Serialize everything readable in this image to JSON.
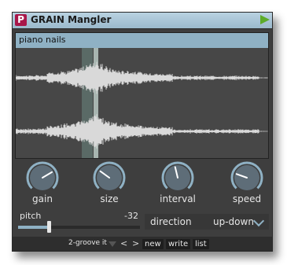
{
  "window": {
    "badge": "P",
    "title": "GRAIN Mangler"
  },
  "waveform": {
    "sample_name": "piano nails"
  },
  "knobs": [
    {
      "id": "gain",
      "label": "gain",
      "value": 0.72
    },
    {
      "id": "size",
      "label": "size",
      "value": 0.3
    },
    {
      "id": "interval",
      "label": "interval",
      "value": 0.45
    },
    {
      "id": "speed",
      "label": "speed",
      "value": 0.24
    }
  ],
  "pitch": {
    "label": "pitch",
    "value": "-32",
    "fraction": 0.25
  },
  "direction": {
    "label": "direction",
    "value": "up-down"
  },
  "footer": {
    "preset_name": "2-groove it",
    "prev": "<",
    "next": ">",
    "new_label": "new",
    "write_label": "write",
    "list_label": "list"
  },
  "colors": {
    "accent": "#8fb1c4",
    "badge": "#a8174a",
    "play": "#5cab2a"
  },
  "icons": {
    "play": "play-icon",
    "dropdown": "chevron-down-icon"
  }
}
